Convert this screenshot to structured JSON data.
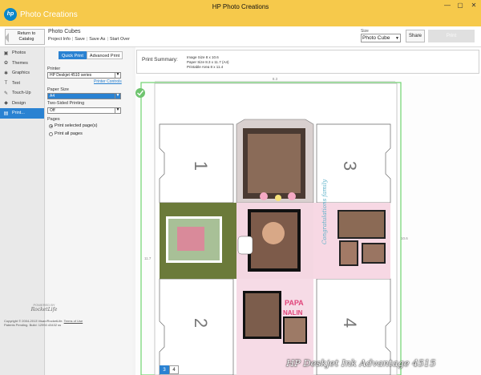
{
  "window": {
    "title": "HP Photo Creations",
    "app_name": "Photo Creations",
    "logo_text": "hp"
  },
  "topbar": {
    "return_label_line1": "Return to",
    "return_label_line2": "Catalog",
    "project_title": "Photo Cubes",
    "links": [
      "Project Info",
      "Save",
      "Save As",
      "Start Over"
    ],
    "size_label": "Size",
    "size_value": "Photo Cube",
    "share_label": "Share",
    "print_label": "Print"
  },
  "nav": [
    {
      "label": "Photos",
      "icon": "photos-icon",
      "glyph": "▣"
    },
    {
      "label": "Themes",
      "icon": "themes-icon",
      "glyph": "✿"
    },
    {
      "label": "Graphics",
      "icon": "graphics-icon",
      "glyph": "✱"
    },
    {
      "label": "Text",
      "icon": "text-icon",
      "glyph": "T"
    },
    {
      "label": "Touch-Up",
      "icon": "touch-up-icon",
      "glyph": "✎"
    },
    {
      "label": "Design",
      "icon": "design-icon",
      "glyph": "◆"
    },
    {
      "label": "Print...",
      "icon": "print-icon",
      "glyph": "▤"
    }
  ],
  "settings": {
    "tab_quick": "Quick Print",
    "tab_advanced": "Advanced Print",
    "printer_label": "Printer",
    "printer_value": "HP Deskjet 4510 series",
    "printer_controls_link": "Printer Controls",
    "paper_label": "Paper Size",
    "paper_value": "A4",
    "two_sided_label": "Two-Sided Printing",
    "two_sided_value": "Off",
    "pages_label": "Pages",
    "radio_selected": "Print selected page(s)",
    "radio_all": "Print all pages"
  },
  "footer": {
    "powered_by": "POWERED BY",
    "powered_sig": "RocketLife",
    "copyright": "Copyright © 2004-2013 Visan/RocketLife.",
    "terms": "Terms of Use",
    "patents": "Patents Pending. Build: 12992.43432 ss"
  },
  "summary": {
    "title": "Print Summary:",
    "image_size": "Image Size 8 x 10.6",
    "paper_size": "Paper Size 8.3 x 11.7 (A4)",
    "printable_area": "Printable Area 8 x 11.4"
  },
  "canvas": {
    "ruler_top": "8.3",
    "ruler_left": "11.7",
    "ruler_right": "10.6",
    "faces": [
      "1",
      "2",
      "3",
      "4"
    ],
    "photo_captions": [
      "PAPA",
      "NALIN"
    ],
    "side_caption": "Congratulations family"
  },
  "pager": [
    "3",
    "4"
  ],
  "bottom_label": "HP Deskjet Ink Advantage 4515"
}
